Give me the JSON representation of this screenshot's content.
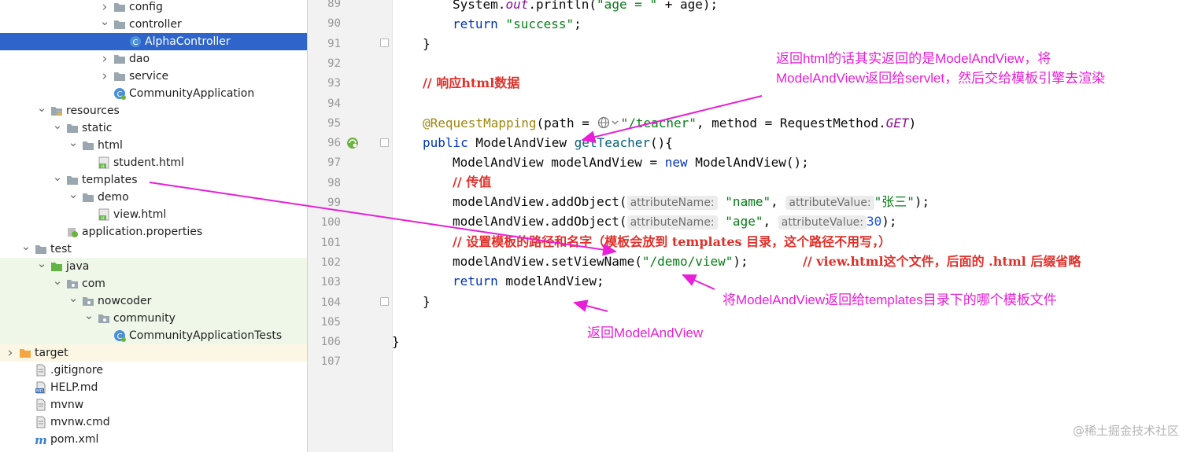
{
  "tree": {
    "items": [
      {
        "label": "config",
        "depth": 6,
        "icon": "folder",
        "chevron": "right"
      },
      {
        "label": "controller",
        "depth": 6,
        "icon": "folder",
        "chevron": "down"
      },
      {
        "label": "AlphaController",
        "depth": 7,
        "icon": "class",
        "chevron": "",
        "selected": true
      },
      {
        "label": "dao",
        "depth": 6,
        "icon": "folder",
        "chevron": "right"
      },
      {
        "label": "service",
        "depth": 6,
        "icon": "folder",
        "chevron": "right"
      },
      {
        "label": "CommunityApplication",
        "depth": 6,
        "icon": "springboot-class",
        "chevron": ""
      },
      {
        "label": "resources",
        "depth": 2,
        "icon": "resources-folder",
        "chevron": "down"
      },
      {
        "label": "static",
        "depth": 3,
        "icon": "folder",
        "chevron": "down"
      },
      {
        "label": "html",
        "depth": 4,
        "icon": "folder",
        "chevron": "down"
      },
      {
        "label": "student.html",
        "depth": 5,
        "icon": "html-file",
        "chevron": ""
      },
      {
        "label": "templates",
        "depth": 3,
        "icon": "folder",
        "chevron": "down"
      },
      {
        "label": "demo",
        "depth": 4,
        "icon": "folder",
        "chevron": "down"
      },
      {
        "label": "view.html",
        "depth": 5,
        "icon": "html-file",
        "chevron": ""
      },
      {
        "label": "application.properties",
        "depth": 3,
        "icon": "properties-file",
        "chevron": ""
      },
      {
        "label": "test",
        "depth": 1,
        "icon": "folder",
        "chevron": "down"
      },
      {
        "label": "java",
        "depth": 2,
        "icon": "test-folder",
        "chevron": "down",
        "test": true
      },
      {
        "label": "com",
        "depth": 3,
        "icon": "package",
        "chevron": "down",
        "test": true
      },
      {
        "label": "nowcoder",
        "depth": 4,
        "icon": "package",
        "chevron": "down",
        "test": true
      },
      {
        "label": "community",
        "depth": 5,
        "icon": "package",
        "chevron": "down",
        "test": true
      },
      {
        "label": "CommunityApplicationTests",
        "depth": 6,
        "icon": "springboot-class",
        "chevron": "",
        "test": true
      },
      {
        "label": "target",
        "depth": 0,
        "icon": "excluded-folder",
        "chevron": "right",
        "excluded": true
      },
      {
        "label": ".gitignore",
        "depth": 1,
        "icon": "text-file",
        "chevron": ""
      },
      {
        "label": "HELP.md",
        "depth": 1,
        "icon": "markdown-file",
        "chevron": ""
      },
      {
        "label": "mvnw",
        "depth": 1,
        "icon": "text-file",
        "chevron": ""
      },
      {
        "label": "mvnw.cmd",
        "depth": 1,
        "icon": "text-file",
        "chevron": ""
      },
      {
        "label": "pom.xml",
        "depth": 1,
        "icon": "maven-file",
        "chevron": ""
      }
    ]
  },
  "editor": {
    "line_numbers": [
      "89",
      "90",
      "91",
      "92",
      "93",
      "94",
      "95",
      "96",
      "97",
      "98",
      "99",
      "100",
      "101",
      "102",
      "103",
      "104",
      "105",
      "106",
      "107"
    ],
    "code": {
      "l89_a": "System.",
      "l89_b": "out",
      "l89_c": ".println(",
      "l89_d": "\"age = \"",
      "l89_e": " + age);",
      "l90_kw": "return",
      "l90_str": " \"success\"",
      "l90_end": ";",
      "l91": "}",
      "l93": "// 响应html数据",
      "l95_ann": "@RequestMapping",
      "l95_a": "(path = ",
      "l95_str": "\"/teacher\"",
      "l95_b": ", method = RequestMethod.",
      "l95_get": "GET",
      "l95_c": ")",
      "l96_kw": "public",
      "l96_a": " ModelAndView ",
      "l96_m": "getTeacher",
      "l96_b": "(){",
      "l97_a": "ModelAndView modelAndView = ",
      "l97_kw": "new",
      "l97_b": " ModelAndView();",
      "l98": "// 传值",
      "l99_a": "modelAndView.addObject(",
      "l99_h1": "attributeName:",
      "l99_s1": "\"name\"",
      "l99_b": ",",
      "l99_h2": "attributeValue:",
      "l99_s2": "\"张三\"",
      "l99_c": ");",
      "l100_a": "modelAndView.addObject(",
      "l100_h1": "attributeName:",
      "l100_s1": "\"age\"",
      "l100_b": ",",
      "l100_h2": "attributeValue:",
      "l100_n": "30",
      "l100_c": ");",
      "l101": "// 设置模板的路径和名字（模板会放到 templates 目录，这个路径不用写，）",
      "l102_a": "modelAndView.setViewName(",
      "l102_s": "\"/demo/view\"",
      "l102_b": ");",
      "l102_cmt": "// view.html这个文件，后面的 .html 后缀省略",
      "l103_kw": "return",
      "l103_a": " modelAndView;",
      "l104": "}",
      "l106": "}"
    }
  },
  "annotations": {
    "note1_line1": "返回html的话其实返回的是ModelAndView，将",
    "note1_line2": "ModelAndView返回给servlet，然后交给模板引擎去渲染",
    "note2": "将ModelAndView返回给templates目录下的哪个模板文件",
    "note3": "返回ModelAndView"
  },
  "watermark": "@稀土掘金技术社区",
  "colors": {
    "selection": "#2f65ca",
    "annotation": "#e81ed8",
    "keyword": "#0033b3",
    "string": "#067d17",
    "comment": "#e0302a"
  }
}
